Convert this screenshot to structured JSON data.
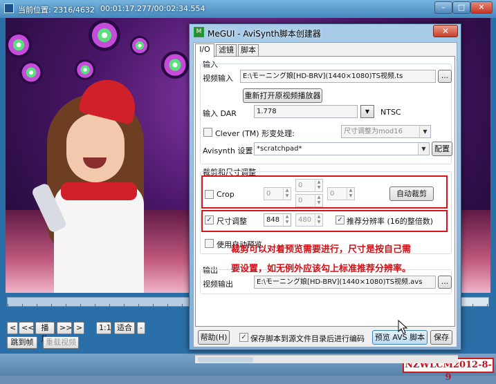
{
  "player": {
    "position_label": "当前位置: 2316/4632",
    "timecode": "00:01:17.277/00:02:34.554",
    "controls": [
      "<",
      "<<",
      "播放",
      ">>",
      ">",
      "1:1",
      "适合",
      "-"
    ],
    "goto_frame": "跳到帧",
    "reload_video": "重载视频",
    "progress": 0.5
  },
  "dialog": {
    "title": "MeGUI - AviSynth脚本创建器",
    "close_glyph": "✕",
    "tabs": [
      "I/O",
      "滤镜",
      "脚本"
    ],
    "input_group": "输入",
    "video_input_label": "视频输入",
    "video_input_value": "E:\\モーニング娘[HD-BRV](1440×1080)TS视频.ts",
    "browse": "...",
    "reopen_button": "重新打开原视频播放器",
    "dar_label": "输入 DAR",
    "dar_value": "1.778",
    "ntsc_label": "NTSC",
    "clever_label": "Clever (TM) 形变处理:",
    "clever_combo": "尺寸调整为mod16",
    "avisynth_label": "Avisynth 设置",
    "avisynth_value": "*scratchpad*",
    "config_button": "配置",
    "crop_group": "裁剪和尺寸调整",
    "crop_label": "Crop",
    "crop_values": [
      "0",
      "0",
      "0",
      "0"
    ],
    "autocrop_button": "自动裁剪",
    "resize_label": "尺寸调整",
    "resize_width": "848",
    "resize_height": "480",
    "suggest_label": "推荐分辨率 (16的整倍数)",
    "auto_preview_label": "使用自动预览",
    "output_group": "输出",
    "video_output_label": "视频输出",
    "video_output_value": "E:\\モーニング娘[HD-BRV](1440×1080)TS视频.avs",
    "help_button": "帮助(H)",
    "save_to_source_label": "保存脚本到源文件目录后进行编码",
    "preview_button": "预览 AVS 脚本",
    "save_button": "保存"
  },
  "annotation": {
    "line1": "裁剪可以对着预览需要进行，尺寸是按自己需",
    "line2": "要设置，如无例外应该勾上标准推荐分辨率。"
  },
  "watermark": "NZWLCM2012-8-9",
  "colors": {
    "annotation_red": "#d10f16",
    "title_bar": "#7eaed6"
  }
}
